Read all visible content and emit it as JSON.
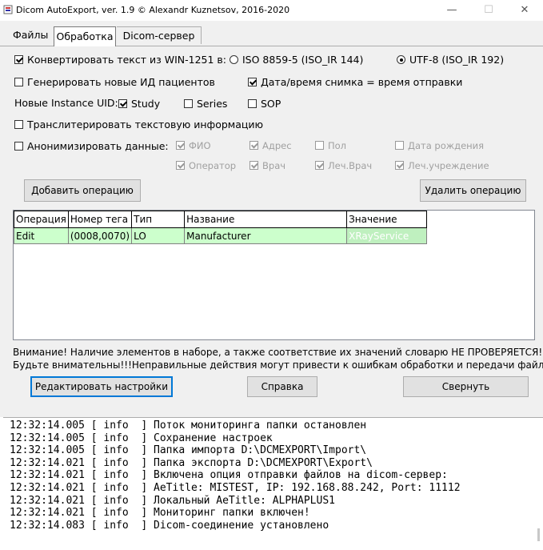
{
  "window": {
    "title": "Dicom AutoExport, ver. 1.9 © Alexandr Kuznetsov, 2016-2020",
    "minimize": "—",
    "maximize": "☐",
    "close": "✕"
  },
  "tabs": {
    "files": "Файлы",
    "processing": "Обработка",
    "dicom_server": "Dicom-сервер"
  },
  "options": {
    "convert_label": "Конвертировать текст из WIN-1251 в:",
    "convert_checked": true,
    "encoding_iso": "ISO 8859-5 (ISO_IR 144)",
    "encoding_utf8": "UTF-8 (ISO_IR 192)",
    "encoding_selected": "utf8",
    "gen_ids": "Генерировать новые ИД пациентов",
    "gen_ids_checked": false,
    "datetime": "Дата/время снимка = время отправки",
    "datetime_checked": true,
    "new_uid_label": "Новые Instance UID:",
    "uid_study": "Study",
    "uid_series": "Series",
    "uid_sop": "SOP",
    "translit": "Транслитерировать текстовую информацию",
    "anonymize": "Анонимизировать данные:",
    "anon_fio": "ФИО",
    "anon_address": "Адрес",
    "anon_sex": "Пол",
    "anon_birth": "Дата рождения",
    "anon_operator": "Оператор",
    "anon_doctor": "Врач",
    "anon_att_doctor": "Леч.Врач",
    "anon_institution": "Леч.учреждение"
  },
  "buttons": {
    "add_operation": "Добавить операцию",
    "delete_operation": "Удалить операцию",
    "edit_settings": "Редактировать настройки",
    "help": "Справка",
    "collapse": "Свернуть"
  },
  "grid": {
    "columns": [
      "Операция",
      "Номер тега",
      "Тип",
      "Название",
      "Значение"
    ],
    "rows": [
      [
        "Edit",
        "(0008,0070)",
        "LO",
        "Manufacturer",
        "XRayService"
      ]
    ]
  },
  "warning": {
    "line1": "Внимание! Наличие элементов в наборе, а также соответствие их значений словарю НЕ ПРОВЕРЯЕТСЯ!",
    "line2": "Будьте внимательны!!!Неправильные действия могут привести к ошибкам обработки и передачи файлов!"
  },
  "log": [
    "12:32:14.005 [ info  ] Поток мониторинга папки остановлен",
    "12:32:14.005 [ info  ] Сохранение настроек",
    "12:32:14.005 [ info  ] Папка импорта D:\\DCMEXPORT\\Import\\",
    "12:32:14.021 [ info  ] Папка экспорта D:\\DCMEXPORT\\Export\\",
    "12:32:14.021 [ info  ] Включена опция отправки файлов на dicom-сервер:",
    "12:32:14.021 [ info  ] AeTitle: MISTEST, IP: 192.168.88.242, Port: 11112",
    "12:32:14.021 [ info  ] Локальный AeTitle: ALPHAPLUS1",
    "12:32:14.021 [ info  ] Мониторинг папки включен!",
    "12:32:14.083 [ info  ] Dicom-соединение установлено"
  ]
}
